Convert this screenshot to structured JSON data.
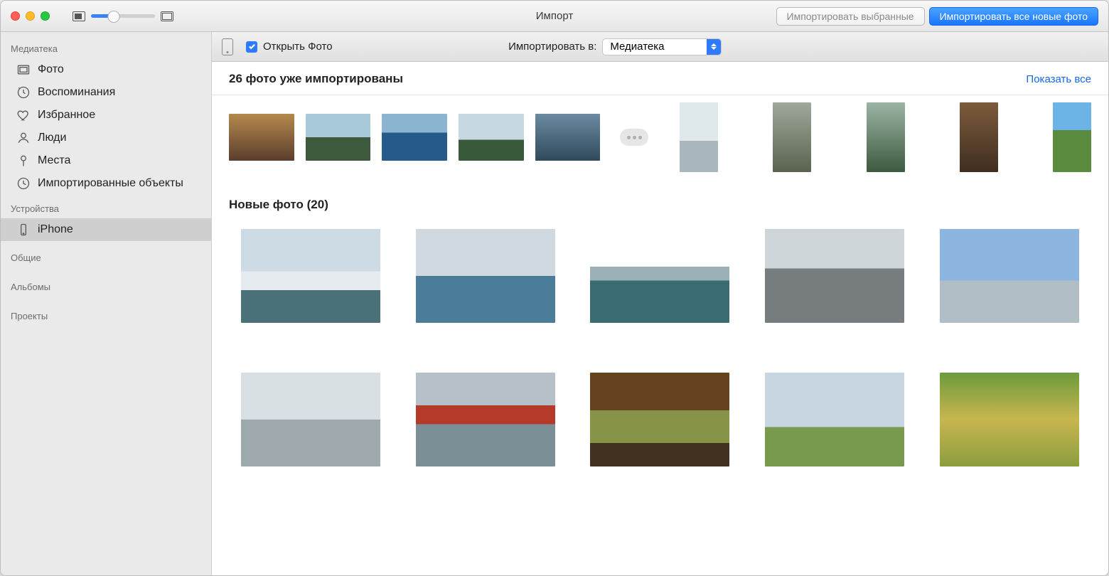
{
  "titlebar": {
    "windowTitle": "Импорт",
    "importSelected": "Импортировать выбранные",
    "importAllNew": "Импортировать все новые фото"
  },
  "subbar": {
    "openPhotosLabel": "Открыть Фото",
    "openPhotosChecked": true,
    "importToLabel": "Импортировать в:",
    "importToValue": "Медиатека"
  },
  "sidebar": {
    "sectionLibrary": "Медиатека",
    "items": {
      "photos": "Фото",
      "memories": "Воспоминания",
      "favorites": "Избранное",
      "people": "Люди",
      "places": "Места",
      "imports": "Импортированные объекты"
    },
    "sectionDevices": "Устройства",
    "deviceName": "iPhone",
    "sectionShared": "Общие",
    "sectionAlbums": "Альбомы",
    "sectionProjects": "Проекты"
  },
  "main": {
    "alreadyImportedTitle": "26 фото уже импортированы",
    "showAll": "Показать все",
    "newPhotosTitle": "Новые фото (20)"
  }
}
